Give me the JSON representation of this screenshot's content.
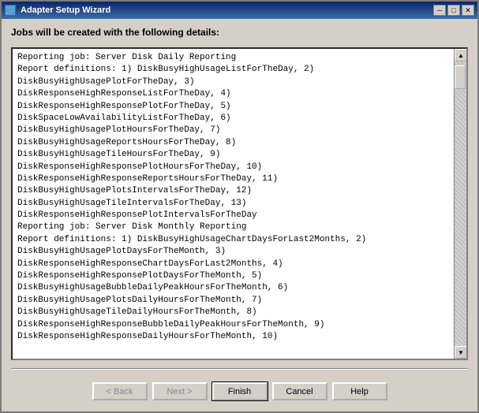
{
  "window": {
    "title": "Adapter Setup Wizard",
    "close_label": "×",
    "minimize_label": "─",
    "maximize_label": "□"
  },
  "main": {
    "section_title": "Jobs will be created with the following details:",
    "content_lines": [
      "Reporting job: Server Disk Daily Reporting",
      "Report definitions: 1) DiskBusyHighUsageListForTheDay, 2)",
      "DiskBusyHighUsagePlotForTheDay, 3)",
      "DiskResponseHighResponseListForTheDay, 4)",
      "DiskResponseHighResponsePlotForTheDay, 5)",
      "DiskSpaceLowAvailabilityListForTheDay, 6)",
      "DiskBusyHighUsagePlotHoursForTheDay, 7)",
      "DiskBusyHighUsageReportsHoursForTheDay, 8)",
      "DiskBusyHighUsageTileHoursForTheDay, 9)",
      "DiskResponseHighResponsePlotHoursForTheDay, 10)",
      "DiskResponseHighResponseReportsHoursForTheDay, 11)",
      "DiskBusyHighUsagePlotsIntervalsForTheDay, 12)",
      "DiskBusyHighUsageTileIntervalsForTheDay, 13)",
      "DiskResponseHighResponsePlotIntervalsForTheDay",
      "",
      "Reporting job: Server Disk Monthly Reporting",
      "Report definitions: 1) DiskBusyHighUsageChartDaysForLast2Months, 2)",
      "DiskBusyHighUsagePlotDaysForTheMonth, 3)",
      "DiskResponseHighResponseChartDaysForLast2Months, 4)",
      "DiskResponseHighResponsePlotDaysForTheMonth, 5)",
      "DiskBusyHighUsageBubbleDailyPeakHoursForTheMonth, 6)",
      "DiskBusyHighUsagePlotsDailyHoursForTheMonth, 7)",
      "DiskBusyHighUsageTileDailyHoursForTheMonth, 8)",
      "DiskResponseHighResponseBubbleDailyPeakHoursForTheMonth, 9)",
      "DiskResponseHighResponseDailyHoursForTheMonth, 10)"
    ]
  },
  "buttons": {
    "back_label": "< Back",
    "next_label": "Next >",
    "finish_label": "Finish",
    "cancel_label": "Cancel",
    "help_label": "Help"
  },
  "icons": {
    "scroll_up": "▲",
    "scroll_down": "▼",
    "close": "✕",
    "minimize": "─",
    "maximize": "□"
  }
}
